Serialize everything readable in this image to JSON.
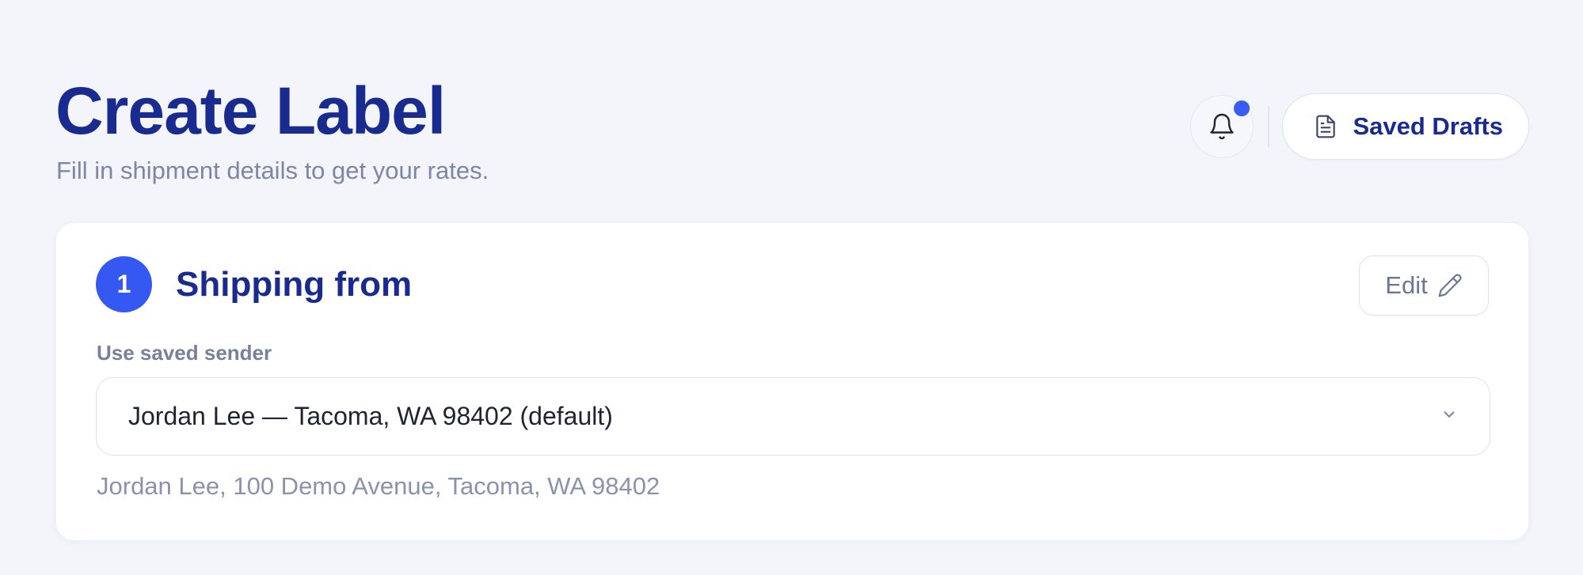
{
  "header": {
    "title": "Create Label",
    "subtitle": "Fill in shipment details to get your rates.",
    "actions": {
      "bell_icon": "bell-icon",
      "has_notification": true,
      "saved_drafts_icon": "document-icon",
      "saved_drafts_label": "Saved Drafts"
    }
  },
  "shipping_from": {
    "step_number": "1",
    "title": "Shipping from",
    "edit_label": "Edit",
    "edit_icon": "pencil-icon",
    "saved_sender_label": "Use saved sender",
    "selected_sender": "Jordan Lee — Tacoma, WA 98402 (default)",
    "address_preview": "Jordan Lee, 100 Demo Avenue, Tacoma, WA 98402"
  },
  "colors": {
    "background": "#f3f5fa",
    "primary_text": "#1a2b8f",
    "accent": "#3558f2",
    "muted_text": "#7d86a4",
    "card": "#ffffff"
  }
}
